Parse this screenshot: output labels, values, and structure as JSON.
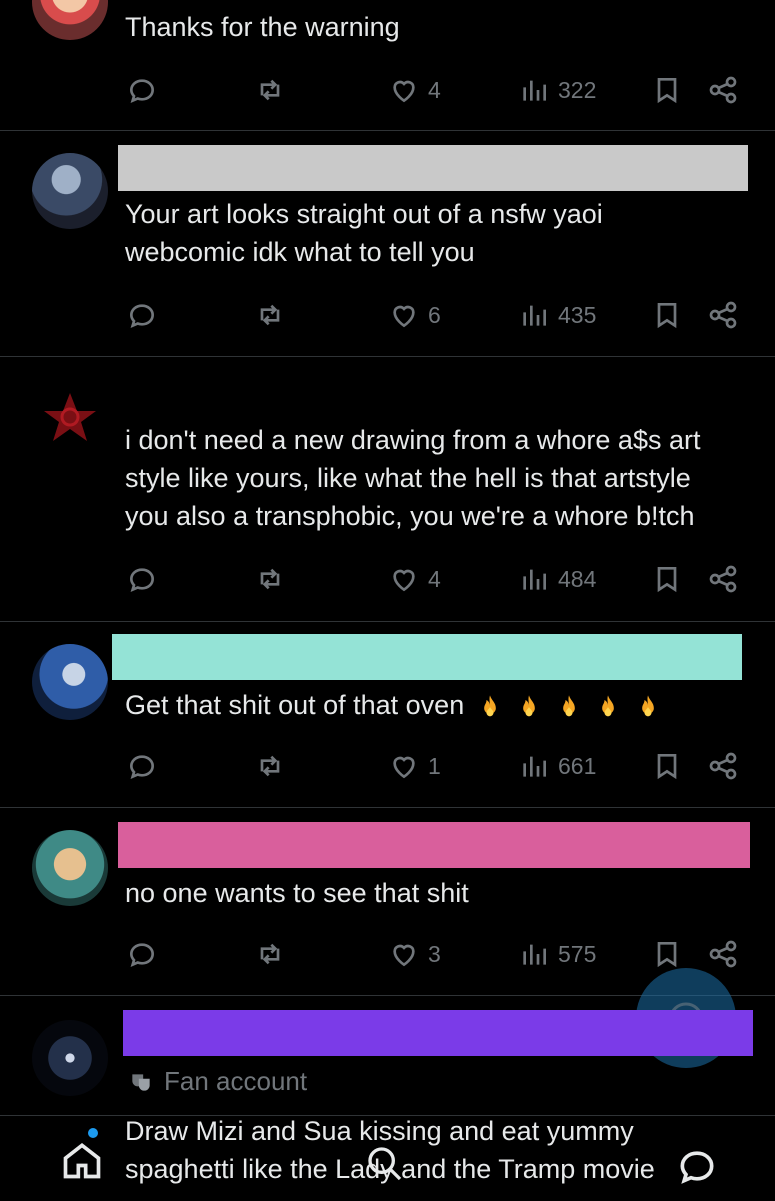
{
  "posts": [
    {
      "text_lines": [
        "Thanks for the warning"
      ],
      "reply_count": "",
      "likes": "4",
      "views": "322"
    },
    {
      "name_bar_color": "#c9c9c9",
      "text_lines": [
        "Your art looks straight out of a nsfw yaoi",
        "webcomic idk what to tell you"
      ],
      "likes": "6",
      "views": "435"
    },
    {
      "text_lines": [
        "i don't need a new drawing from a whore a$s art",
        "style like yours, like what the hell is that artstyle",
        "you also a transphobic, you we're a whore b!tch"
      ],
      "likes": "4",
      "views": "484"
    },
    {
      "name_bar_color": "#94e3d6",
      "text_lines": [
        "Get that shit out of that oven"
      ],
      "emoji": [
        "fire",
        "fire",
        "fire",
        "fire",
        "fire"
      ],
      "likes": "1",
      "views": "661"
    },
    {
      "name_bar_color": "#d95f9c",
      "text_lines": [
        "no one wants to see that shit"
      ],
      "likes": "3",
      "views": "575"
    },
    {
      "name_bar_color": "#7b3be8",
      "badge": "Fan account",
      "text_lines": [
        "Draw Mizi and Sua kissing and eat yummy",
        "spaghetti like the Lady and the Tramp movie"
      ]
    }
  ],
  "icons": {
    "reply": "reply-icon",
    "repost": "repost-icon",
    "like": "heart-icon",
    "views": "views-icon",
    "bookmark": "bookmark-icon",
    "share": "share-icon",
    "home": "home-icon",
    "search": "search-icon",
    "messages": "messages-icon",
    "fab": "compose-icon"
  },
  "colors": {
    "background": "#000000",
    "text": "#e7e9ea",
    "muted": "#71767b",
    "divider": "#2f3336",
    "accent": "#1d9bf0"
  }
}
